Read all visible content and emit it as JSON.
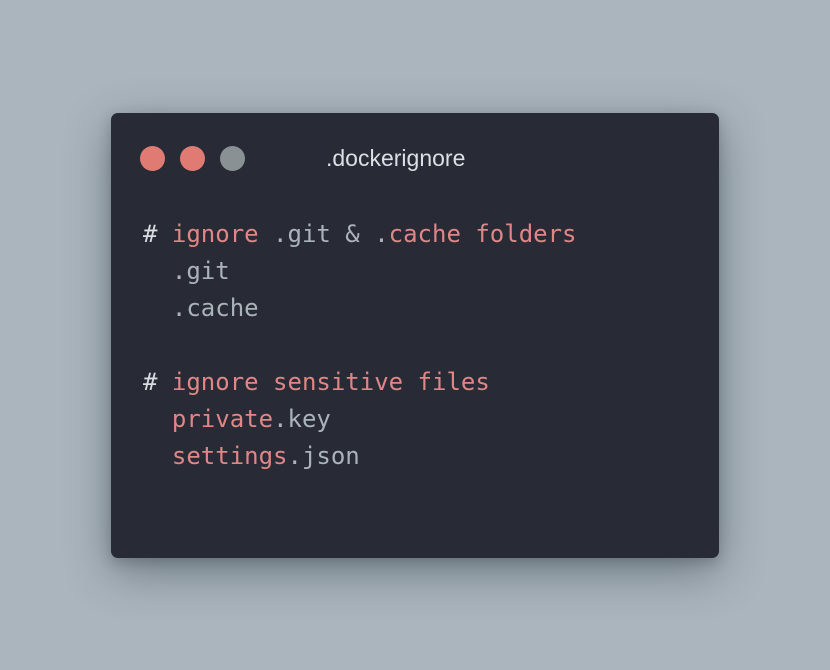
{
  "window": {
    "title": ".dockerignore",
    "buttons": {
      "close_color": "#e07b74",
      "minimize_color": "#e07b74",
      "maximize_color": "#8a9195"
    }
  },
  "code": {
    "lines": [
      {
        "tokens": [
          {
            "text": "# ",
            "kind": "hash"
          },
          {
            "text": "ignore",
            "kind": "kw"
          },
          {
            "text": " .git & .",
            "kind": "plain"
          },
          {
            "text": "cache folders",
            "kind": "kw"
          }
        ]
      },
      {
        "tokens": [
          {
            "text": "  .git",
            "kind": "plain"
          }
        ]
      },
      {
        "tokens": [
          {
            "text": "  .cache",
            "kind": "plain"
          }
        ]
      },
      {
        "tokens": []
      },
      {
        "tokens": [
          {
            "text": "# ",
            "kind": "hash"
          },
          {
            "text": "ignore sensitive files",
            "kind": "kw"
          }
        ]
      },
      {
        "tokens": [
          {
            "text": "  ",
            "kind": "plain"
          },
          {
            "text": "private",
            "kind": "kw"
          },
          {
            "text": ".key",
            "kind": "plain"
          }
        ]
      },
      {
        "tokens": [
          {
            "text": "  ",
            "kind": "plain"
          },
          {
            "text": "settings",
            "kind": "kw"
          },
          {
            "text": ".json",
            "kind": "plain"
          }
        ]
      }
    ]
  },
  "colors": {
    "background": "#aab5bd",
    "editor_background": "#282a35",
    "keyword": "#e08686",
    "plain_text": "#abb3ba",
    "comment_hash": "#d8dde1",
    "title_text": "#dcdfe4"
  }
}
